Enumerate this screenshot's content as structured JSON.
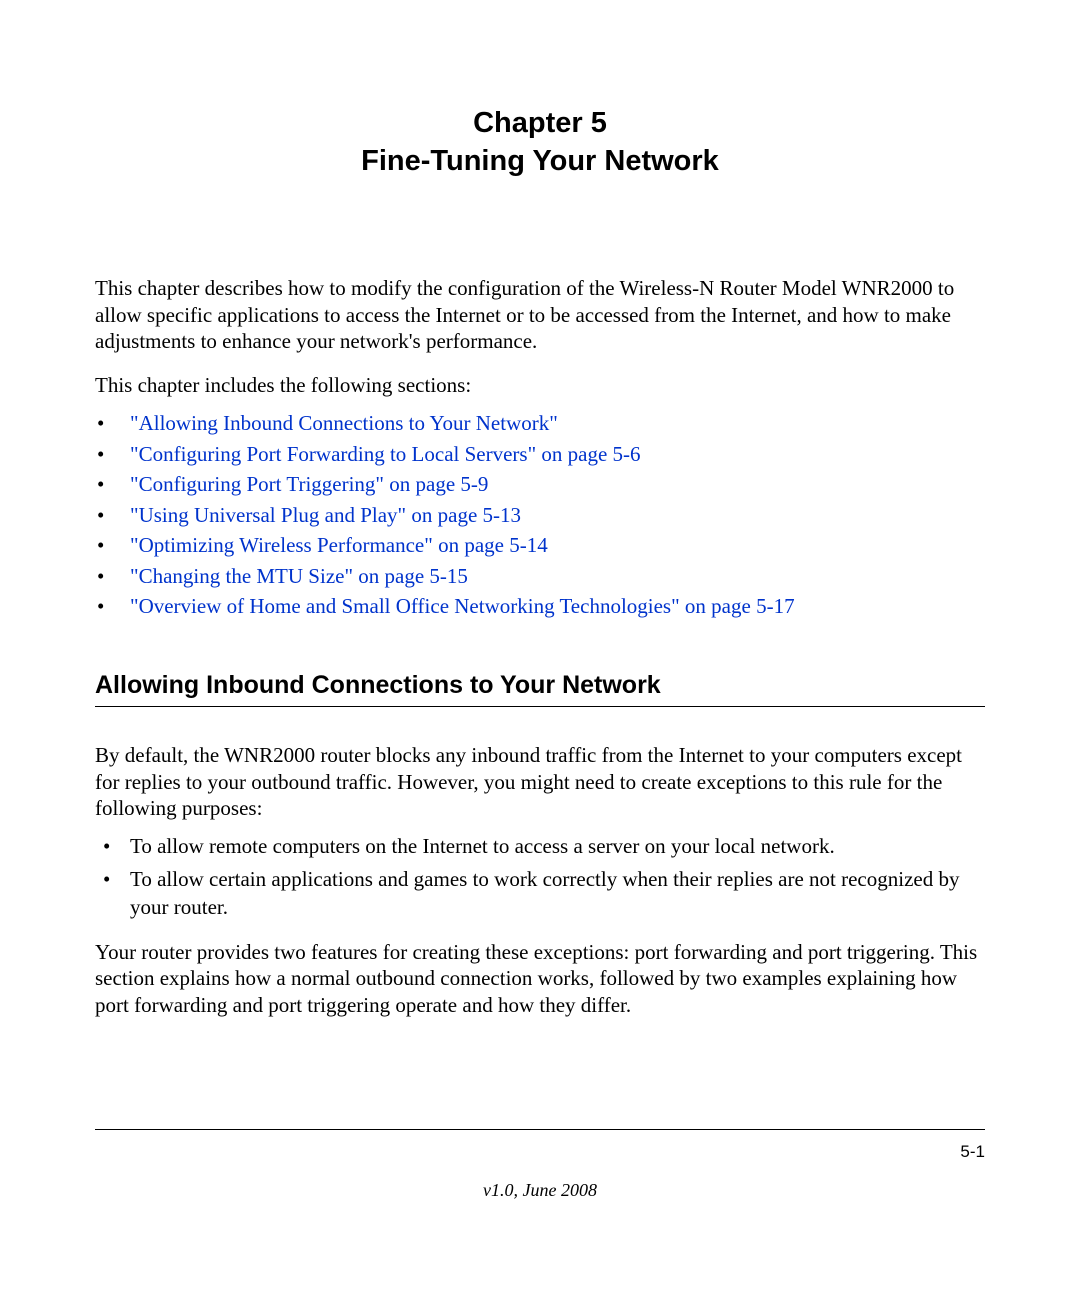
{
  "chapter": {
    "number": "Chapter 5",
    "title": "Fine-Tuning Your Network"
  },
  "intro": "This chapter describes how to modify the configuration of the Wireless-N Router Model WNR2000 to allow specific applications to access the Internet or to be accessed from the Internet, and how to make adjustments to enhance your network's performance.",
  "sections_intro": "This chapter includes the following sections:",
  "toc": [
    "\"Allowing Inbound Connections to Your Network\"",
    "\"Configuring Port Forwarding to Local Servers\" on page 5-6",
    "\"Configuring Port Triggering\" on page 5-9",
    "\"Using Universal Plug and Play\" on page 5-13",
    "\"Optimizing Wireless Performance\" on page 5-14",
    "\"Changing the MTU Size\" on page 5-15",
    "\"Overview of Home and Small Office Networking Technologies\" on page 5-17"
  ],
  "section": {
    "heading": "Allowing Inbound Connections to Your Network",
    "para1": "By default, the WNR2000 router blocks any inbound traffic from the Internet to your computers except for replies to your outbound traffic. However, you might need to create exceptions to this rule for the following purposes:",
    "purposes": [
      "To allow remote computers on the Internet to access a server on your local network.",
      "To allow certain applications and games to work correctly when their replies are not recognized by your router."
    ],
    "para2": "Your router provides two features for creating these exceptions: port forwarding and port triggering. This section explains how a normal outbound connection works, followed by two examples explaining how port forwarding and port triggering operate and how they differ."
  },
  "footer": {
    "page_num": "5-1",
    "version": "v1.0, June 2008"
  }
}
